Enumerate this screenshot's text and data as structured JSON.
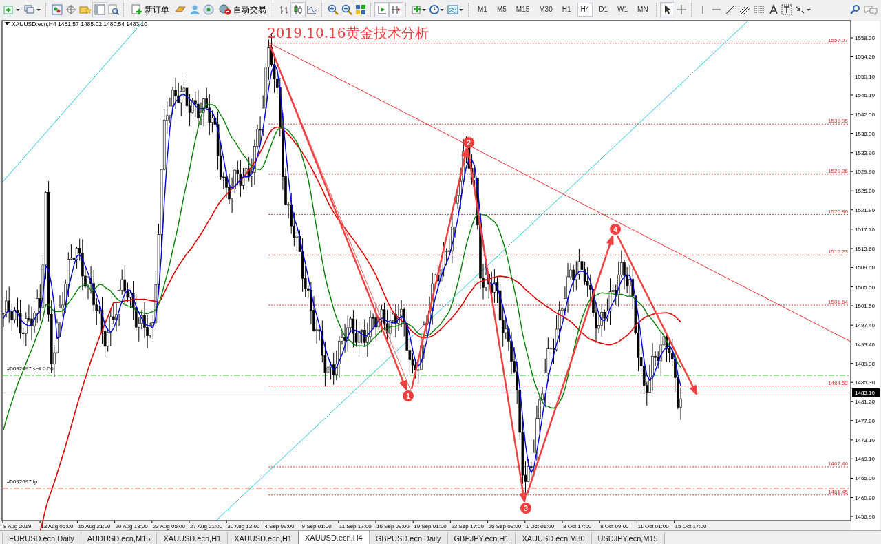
{
  "toolbar": {
    "new_order": "新订单",
    "auto_trading": "自动交易",
    "timeframes": [
      {
        "label": "M1",
        "selected": false
      },
      {
        "label": "M5",
        "selected": false
      },
      {
        "label": "M15",
        "selected": false
      },
      {
        "label": "M30",
        "selected": false
      },
      {
        "label": "H1",
        "selected": false
      },
      {
        "label": "H4",
        "selected": true
      },
      {
        "label": "D1",
        "selected": false
      },
      {
        "label": "W1",
        "selected": false
      },
      {
        "label": "MN",
        "selected": false
      }
    ]
  },
  "chart": {
    "header": "XAUUSD.ecn,H4  1481.57 1485.02 1480.54 1483.10",
    "title": "2019.10.16黄金技术分析",
    "y_ticks": [
      "1558.20",
      "1554.20",
      "1550.10",
      "1546.10",
      "1542.00",
      "1538.00",
      "1533.90",
      "1529.90",
      "1525.80",
      "1521.80",
      "1517.70",
      "1513.60",
      "1509.60",
      "1505.50",
      "1501.50",
      "1497.40",
      "1493.40",
      "1489.30",
      "1485.30",
      "1481.20",
      "1477.20",
      "1473.10",
      "1469.10",
      "1465.00",
      "1460.90",
      "1456.90"
    ],
    "x_ticks": [
      "8 Aug 2019",
      "13 Aug 05:00",
      "15 Aug 21:00",
      "20 Aug 13:00",
      "23 Aug 05:00",
      "27 Aug 21:00",
      "30 Aug 13:00",
      "4 Sep 09:00",
      "9 Sep 01:00",
      "11 Sep 17:00",
      "16 Sep 09:00",
      "19 Sep 01:00",
      "23 Sep 17:00",
      "26 Sep 09:00",
      "1 Oct 01:00",
      "3 Oct 17:00",
      "8 Oct 09:00",
      "11 Oct 01:00",
      "15 Oct 17:00"
    ],
    "levels": [
      {
        "label": "1557.07"
      },
      {
        "label": "1539.95"
      },
      {
        "label": "1529.36"
      },
      {
        "label": "1520.80"
      },
      {
        "label": "1512.23"
      },
      {
        "label": "1501.64"
      },
      {
        "label": "1484.52"
      },
      {
        "label": "1467.40"
      },
      {
        "label": "1461.45"
      }
    ],
    "orders": [
      {
        "label": "#5092697 sell 0.50",
        "kind": "entry"
      },
      {
        "label": "#5092697 tp",
        "kind": "take-profit"
      }
    ],
    "current_price": "1483.10",
    "markers": [
      "1",
      "2",
      "3",
      "4"
    ]
  },
  "tabs": [
    {
      "label": "EURUSD.ecn,Daily",
      "selected": false
    },
    {
      "label": "AUDUSD.ecn,M15",
      "selected": false
    },
    {
      "label": "XAUUSD.ecn,H1",
      "selected": false
    },
    {
      "label": "XAUUSD.ecn,H1",
      "selected": false
    },
    {
      "label": "XAUUSD.ecn,H4",
      "selected": true
    },
    {
      "label": "GBPUSD.ecn,Daily",
      "selected": false
    },
    {
      "label": "GBPJPY.ecn,H1",
      "selected": false
    },
    {
      "label": "XAUUSD.ecn,M30",
      "selected": false
    },
    {
      "label": "USDJPY.ecn,M15",
      "selected": false
    }
  ]
}
